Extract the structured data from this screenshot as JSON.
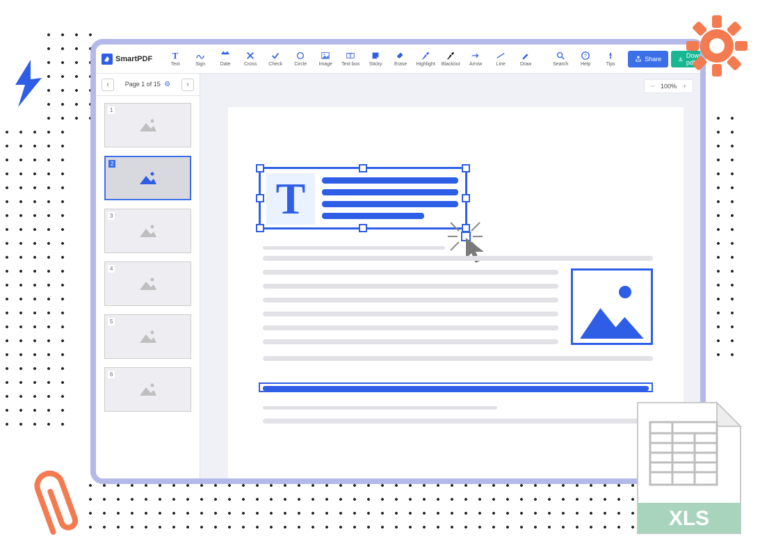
{
  "brand": {
    "name": "SmartPDF"
  },
  "toolbar": {
    "tools": [
      {
        "label": "Text"
      },
      {
        "label": "Sign"
      },
      {
        "label": "Date"
      },
      {
        "label": "Cross"
      },
      {
        "label": "Check"
      },
      {
        "label": "Circle"
      },
      {
        "label": "Image"
      },
      {
        "label": "Text box"
      },
      {
        "label": "Sticky"
      },
      {
        "label": "Erase"
      },
      {
        "label": "Highlight"
      },
      {
        "label": "Blackout"
      },
      {
        "label": "Arrow"
      },
      {
        "label": "Line"
      },
      {
        "label": "Draw"
      }
    ],
    "utility": [
      {
        "label": "Search"
      },
      {
        "label": "Help"
      },
      {
        "label": "Tips"
      }
    ],
    "share_label": "Share",
    "download_label": "Download pdf"
  },
  "sidebar": {
    "page_indicator": "Page 1 of 15",
    "thumbs": [
      {
        "num": "1",
        "selected": false
      },
      {
        "num": "2",
        "selected": true
      },
      {
        "num": "3",
        "selected": false
      },
      {
        "num": "4",
        "selected": false
      },
      {
        "num": "5",
        "selected": false
      },
      {
        "num": "6",
        "selected": false
      }
    ]
  },
  "zoom": {
    "value": "100%"
  },
  "textbox": {
    "glyph": "T"
  },
  "xls": {
    "label": "XLS"
  },
  "colors": {
    "accent": "#3a6fe8",
    "brand_blue": "#2e5ee6",
    "green": "#17b794",
    "orange": "#f47a4f"
  }
}
